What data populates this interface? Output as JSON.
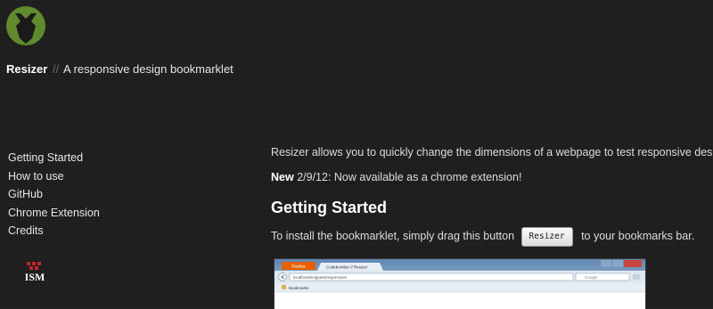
{
  "header": {
    "logo_icon": "bomb-shield-icon",
    "logo_color": "#5f8a2e",
    "title": "Resizer",
    "separator": "//",
    "tagline": "A responsive design bookmarklet"
  },
  "sidebar": {
    "items": [
      {
        "label": "Getting Started"
      },
      {
        "label": "How to use"
      },
      {
        "label": "GitHub"
      },
      {
        "label": "Chrome Extension"
      },
      {
        "label": "Credits"
      }
    ],
    "sponsor_logo_icon": "ism-logo-icon",
    "sponsor_logo_text": "ISM"
  },
  "main": {
    "intro": "Resizer allows you to quickly change the dimensions of a webpage to test responsive design.",
    "news": {
      "badge": "New",
      "text": "2/9/12: Now available as a chrome extension!"
    },
    "getting_started": {
      "heading": "Getting Started",
      "install_before": "To install the bookmarklet, simply drag this button",
      "button_label": "Resizer",
      "install_after": "to your bookmarks bar."
    }
  },
  "browser_screenshot": {
    "menu_label": "Firefox",
    "tab_title": "Codebomber // Resizer",
    "url": "localhost/snippets/responsive/",
    "search_placeholder": "Google",
    "bookmarks_label": "Bookmarks",
    "accent_color": "#e66000"
  }
}
